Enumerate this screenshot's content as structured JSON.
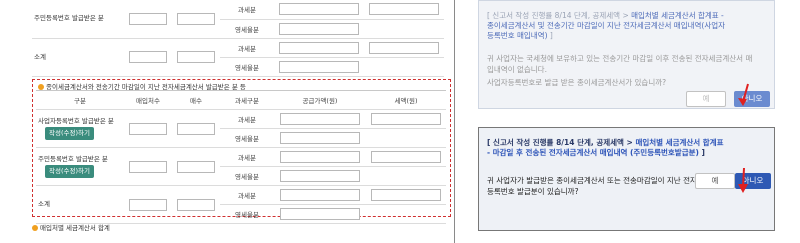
{
  "left": {
    "top_rows": [
      {
        "label": "주민등록번호 발급받은 분",
        "tax_types": [
          "과세분",
          "영세율분"
        ]
      },
      {
        "label": "소계",
        "tax_types": [
          "과세분",
          "영세율분"
        ]
      }
    ],
    "section2_title": "종이세금계산서와 전송기간 마감일이 지난 전자세금계산서 발급받은 분 등",
    "headers": [
      "구분",
      "매입처수",
      "매수",
      "과세구분",
      "공급가액(원)",
      "세액(원)"
    ],
    "section2_rows": [
      {
        "label": "사업자등록번호 발급받은 분",
        "button": "작성(수정)하기",
        "tax_types": [
          "과세분",
          "영세율분"
        ]
      },
      {
        "label": "주민등록번호 발급받은 분",
        "button": "작성(수정)하기",
        "tax_types": [
          "과세분",
          "영세율분"
        ]
      },
      {
        "label": "소계",
        "tax_types": [
          "과세분",
          "영세율분"
        ]
      }
    ],
    "bottom_title": "매입처별 세금계산서 합계"
  },
  "card1": {
    "question_prefix": "[ 신고서 작성 진행률 8/14 단계, 공제세액 > ",
    "question_blue": "매입처별 세금계산서 합계표 - 종이세금계산서 및 전송기간 마감일이 지난 전자세금계산서 매입내역(사업자등록번호 매입내역)",
    "question_suffix": " ]",
    "desc1": "귀 사업자는 국세청에 보유하고 있는 전송기간 마감일 이후 전송된 전자세금계산서 매입내역이 없습니다.",
    "desc2": "사업자등록번호로 발급 받은 종이세금계산서가 있습니까?",
    "yes": "예",
    "no": "아니오"
  },
  "card2": {
    "question_prefix": "[ 신고서 작성 진행률 8/14 단계, 공제세액 > ",
    "question_blue": "매입처별 세금계산서 합계표 - 마감일 후 전송된 전자세금계산서 매입내역 (주민등록번호발급분)",
    "question_suffix": " ]",
    "desc1": "귀 사업자가 발급받은 종이세금계산서 또는 전송마감일이 지난 전자세금계산서 중 주민등록번호 발급분이 있습니까?",
    "yes": "예",
    "no": "아니오"
  },
  "colors": {
    "accent_blue": "#2e59b4",
    "arrow_red": "#e02020",
    "button_green": "#3a8c7d",
    "section_dot": "#f0a020"
  }
}
